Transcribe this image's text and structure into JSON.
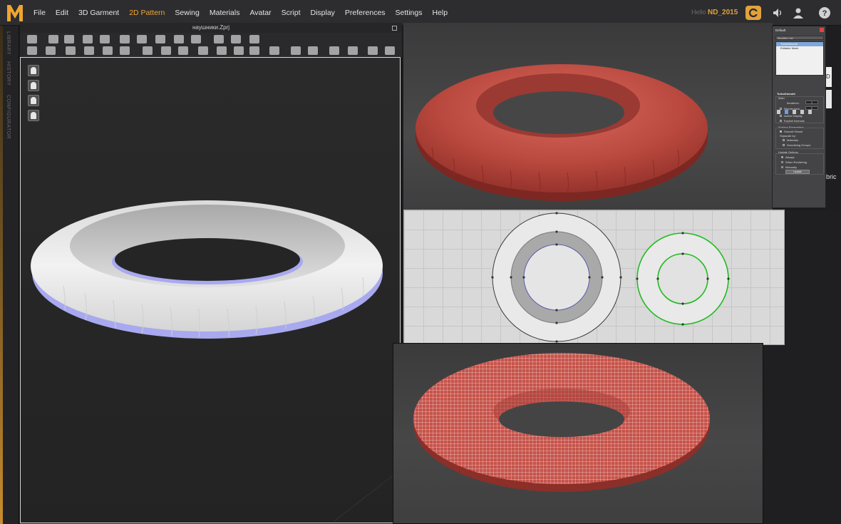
{
  "app": {
    "logo_letter": "M",
    "accent": "#f2a531"
  },
  "menu": [
    "File",
    "Edit",
    "3D Garment",
    "2D Pattern",
    "Sewing",
    "Materials",
    "Avatar",
    "Script",
    "Display",
    "Preferences",
    "Settings",
    "Help"
  ],
  "active_menu": "2D Pattern",
  "user": {
    "label": "Hello",
    "name": "ND_2015"
  },
  "top_icons": [
    "cloud-icon",
    "speaker-icon",
    "user-icon",
    "help-icon"
  ],
  "side_tabs": [
    "LIBRARY",
    "HISTORY",
    "CONFIGURATOR"
  ],
  "window": {
    "title": "наушники.Zprj"
  },
  "avatar_buttons": [
    "garment-view-icon",
    "avatar-view-icon",
    "pattern-view-icon",
    "silhouette-icon"
  ],
  "modifier_panel": {
    "object_name": "Default",
    "dropdown": "Modifier List",
    "stack": [
      "TurboSmooth",
      "Editable Mesh"
    ],
    "section_title": "TurboSmooth",
    "main_label": "Main",
    "iterations_label": "Iterations:",
    "iterations_value": "2",
    "render_iters_label": "Render Iters:",
    "render_iters_value": "0",
    "isoline_label": "Isoline Display",
    "explicit_label": "Explicit Normals",
    "surface_label": "Surface Parameters",
    "smooth_result_label": "Smooth Result",
    "separate_label": "Separate by:",
    "materials_label": "Materials",
    "smoothing_groups_label": "Smoothing Groups",
    "update_options_label": "Update Options",
    "always_label": "Always",
    "when_rendering_label": "When Rendering",
    "manually_label": "Manually",
    "update_button": "Update"
  },
  "right_partial_label": "bric",
  "right_partial_label2": "D"
}
